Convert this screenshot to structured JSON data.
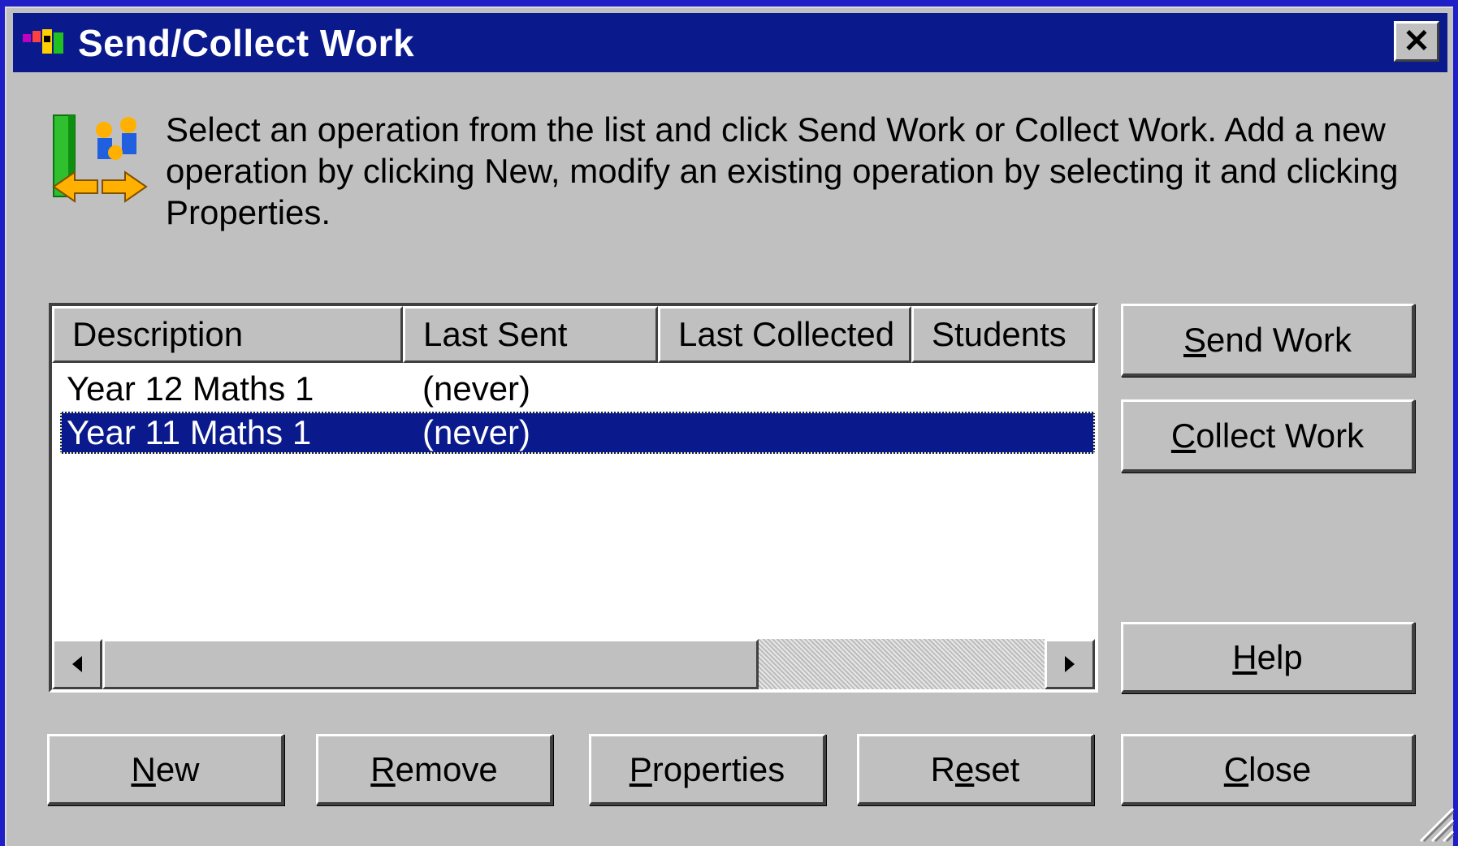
{
  "window": {
    "title": "Send/Collect Work",
    "close_label": "✕",
    "icon": "app-icon"
  },
  "info": {
    "icon": "send-collect-icon",
    "text": "Select an operation from the list and click Send Work or Collect Work. Add a new operation by clicking New, modify an existing operation by selecting it and clicking Properties."
  },
  "list": {
    "columns": [
      "Description",
      "Last Sent",
      "Last Collected",
      "Students"
    ],
    "rows": [
      {
        "description": "Year 12 Maths 1",
        "last_sent": "(never)",
        "selected": false
      },
      {
        "description": "Year 11 Maths 1",
        "last_sent": "(never)",
        "selected": true
      }
    ]
  },
  "buttons": {
    "send_work": {
      "accel": "S",
      "rest": "end Work"
    },
    "collect_work": {
      "accel": "C",
      "rest": "ollect Work"
    },
    "help": {
      "accel": "H",
      "rest": "elp"
    },
    "new": {
      "accel": "N",
      "rest": "ew"
    },
    "remove": {
      "accel": "R",
      "rest": "emove"
    },
    "properties": {
      "accel": "P",
      "rest": "roperties"
    },
    "reset": {
      "pre": "R",
      "accel": "e",
      "rest": "set"
    },
    "close": {
      "accel": "C",
      "rest": "lose"
    }
  },
  "colors": {
    "titlebar": "#0a1a8c",
    "dialog": "#c0c0c0",
    "selection": "#0a1a8c",
    "desktop": "#1f1fc8"
  }
}
